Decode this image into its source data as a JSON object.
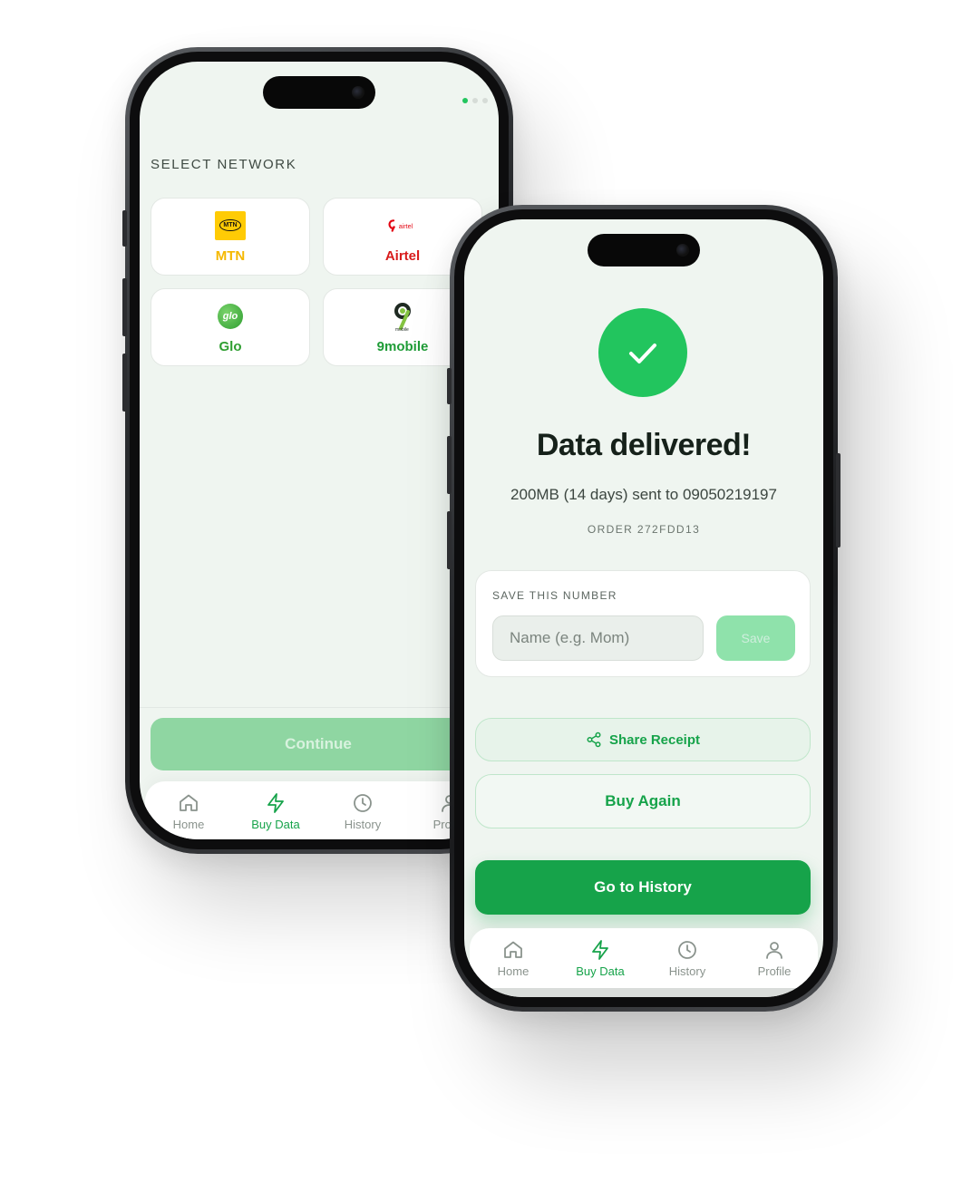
{
  "colors": {
    "accent": "#16a34a",
    "success": "#22c55e",
    "mtn": "#ffcb05",
    "airtel": "#e30613",
    "glo": "#2f9e31",
    "nine_mobile": "#1f9c37"
  },
  "back_phone": {
    "section_title": "SELECT NETWORK",
    "page_indicator": {
      "count": 3,
      "active": 0
    },
    "networks": [
      {
        "label": "MTN",
        "logo_text": "MTN",
        "color": "#f5b800",
        "icon": "mtn-logo"
      },
      {
        "label": "Airtel",
        "logo_text": "airtel",
        "color": "#e30613",
        "icon": "airtel-logo"
      },
      {
        "label": "Glo",
        "logo_text": "glo",
        "color": "#2f9e31",
        "icon": "glo-logo"
      },
      {
        "label": "9mobile",
        "logo_text": "mobile",
        "color": "#1f9c37",
        "icon": "9mobile-logo"
      }
    ],
    "continue_label": "Continue",
    "tabs": [
      {
        "label": "Home",
        "icon": "home-icon",
        "active": false
      },
      {
        "label": "Buy Data",
        "icon": "bolt-icon",
        "active": true
      },
      {
        "label": "History",
        "icon": "clock-icon",
        "active": false
      },
      {
        "label": "Profile",
        "icon": "user-icon",
        "active": false
      }
    ]
  },
  "front_phone": {
    "status_icon": "check-icon",
    "title": "Data delivered!",
    "message": "200MB (14 days) sent to 09050219197",
    "order": "ORDER 272FDD13",
    "save_card": {
      "title": "SAVE THIS NUMBER",
      "name_placeholder": "Name (e.g. Mom)",
      "name_value": "",
      "save_label": "Save"
    },
    "share_label": "Share Receipt",
    "buy_again_label": "Buy Again",
    "history_label": "Go to History",
    "tabs": [
      {
        "label": "Home",
        "icon": "home-icon",
        "active": false
      },
      {
        "label": "Buy Data",
        "icon": "bolt-icon",
        "active": true
      },
      {
        "label": "History",
        "icon": "clock-icon",
        "active": false
      },
      {
        "label": "Profile",
        "icon": "user-icon",
        "active": false
      }
    ]
  }
}
